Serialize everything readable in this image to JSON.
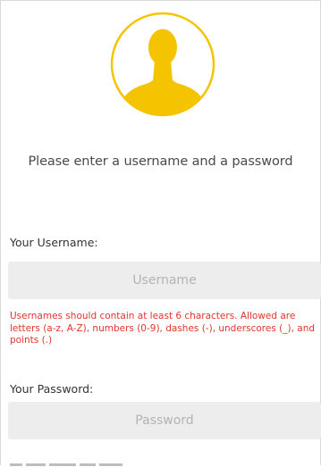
{
  "avatar": {
    "icon": "user-silhouette-icon",
    "color": "#f5c400"
  },
  "prompt": "Please enter a username and a password",
  "username": {
    "label": "Your Username:",
    "placeholder": "Username",
    "value": "",
    "hint": "Usernames should contain at least 6 characters. Allowed are letters (a-z, A-Z), numbers (0-9), dashes (-), underscores (_), and points (.)"
  },
  "password": {
    "label": "Your Password:",
    "placeholder": "Password",
    "value": ""
  },
  "colors": {
    "accent": "#f5c400",
    "error": "#e0342b",
    "input_bg": "#ededed"
  }
}
